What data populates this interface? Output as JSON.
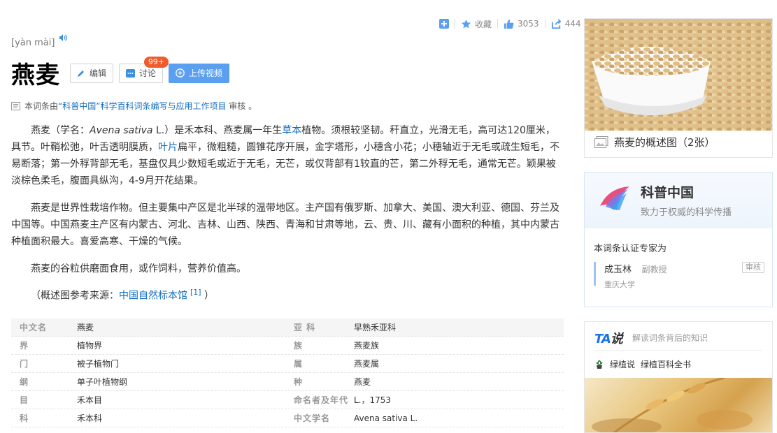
{
  "topbar": {
    "favorite_label": "收藏",
    "like_count": "3053",
    "share_count": "444"
  },
  "entry": {
    "pinyin": "[yàn mài]",
    "title": "燕麦",
    "edit_label": "编辑",
    "discuss_label": "讨论",
    "discuss_badge": "99+",
    "upload_label": "上传视频"
  },
  "review": {
    "prefix": "本词条由",
    "project": "“科普中国”科学百科词条编写与应用工作项目",
    "suffix": " 审核 。"
  },
  "paragraphs": {
    "p1_a": "燕麦（学名：",
    "p1_latin": "Avena sativa",
    "p1_b": " L.）是禾本科、燕麦属一年生",
    "p1_link1": "草本",
    "p1_c": "植物。须根较坚韧。秆直立，光滑无毛，高可达120厘米，具节。叶鞘松弛，叶舌透明膜质，",
    "p1_link2": "叶片",
    "p1_d": "扁平，微粗糙，圆锥花序开展，金字塔形，小穗含小花；小穗轴近于无毛或疏生短毛，不易断落；第一外稃背部无毛，基盘仅具少数短毛或近于无毛，无芒，或仅背部有1较直的芒，第二外稃无毛，通常无芒。颖果被淡棕色柔毛，腹面具纵沟，4-9月开花结果。",
    "p2": "燕麦是世界性栽培作物。但主要集中产区是北半球的温带地区。主产国有俄罗斯、加拿大、美国、澳大利亚、德国、芬兰及中国等。中国燕麦主产区有内蒙古、河北、吉林、山西、陕西、青海和甘肃等地，云、贵、川、藏有小面积的种植，其中内蒙古种植面积最大。喜爱高寒、干燥的气候。",
    "p3": "燕麦的谷粒供磨面食用，或作饲料，营养价值高。",
    "src_prefix": "（概述图参考来源：",
    "src_link": "中国自然标本馆",
    "src_ref": "[1]",
    "src_suffix": " ）"
  },
  "info_rows": [
    {
      "k": "中文名",
      "v": "燕麦",
      "k2": "亚    科",
      "v2": "早熟禾亚科"
    },
    {
      "k": "界",
      "v": "植物界",
      "k2": "族",
      "v2": "燕麦族"
    },
    {
      "k": "门",
      "v": "被子植物门",
      "k2": "属",
      "v2": "燕麦属"
    },
    {
      "k": "纲",
      "v": "单子叶植物纲",
      "k2": "种",
      "v2": "燕麦"
    },
    {
      "k": "目",
      "v": "禾本目",
      "k2": "命名者及年代",
      "v2": "L.，1753"
    },
    {
      "k": "科",
      "v": "禾本科",
      "k2": "中文学名",
      "v2": "Avena sativa L."
    }
  ],
  "sidebar": {
    "album_caption": "燕麦的概述图（2张）",
    "kepu_brand": "科普中国",
    "kepu_slogan": "致力于权威的科学传播",
    "expert_label": "本词条认证专家为",
    "expert_name": "成玉林",
    "expert_rank": "副教授",
    "expert_org": "重庆大学",
    "expert_tag": "审核",
    "ta_logo_a": "TA",
    "ta_logo_b": "说",
    "ta_desc": "解读词条背后的知识",
    "ta_author": "绿植说",
    "ta_title": "绿植百科全书"
  },
  "colors": {
    "link": "#136ec2",
    "accent_blue": "#5a9ff0",
    "badge_red": "#f25a2a"
  }
}
